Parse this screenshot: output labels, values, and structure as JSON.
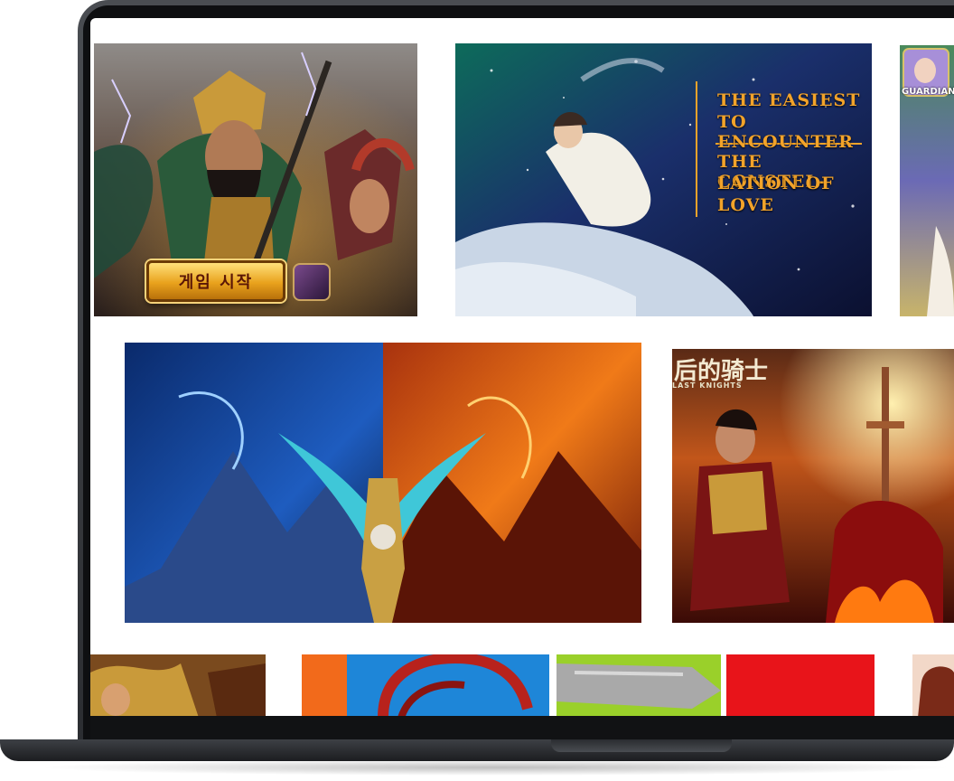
{
  "gallery": {
    "tile1": {
      "cta_label": "게임 시작",
      "icon": "game-app-icon"
    },
    "tile2": {
      "title_line1": "THE EASIEST",
      "title_line2": "TO ENCOUNTER",
      "subtitle_line1": "THE CONSTEL-",
      "subtitle_line2": "LATION OF",
      "subtitle_line3": "LOVE"
    },
    "tile3": {
      "label": "GUARDIAN"
    },
    "tile5": {
      "cjk_title": "后的骑士",
      "en_title": "LAST KNIGHTS"
    }
  },
  "colors": {
    "accent_gold": "#f2a32a",
    "cta_text": "#5a1606"
  }
}
